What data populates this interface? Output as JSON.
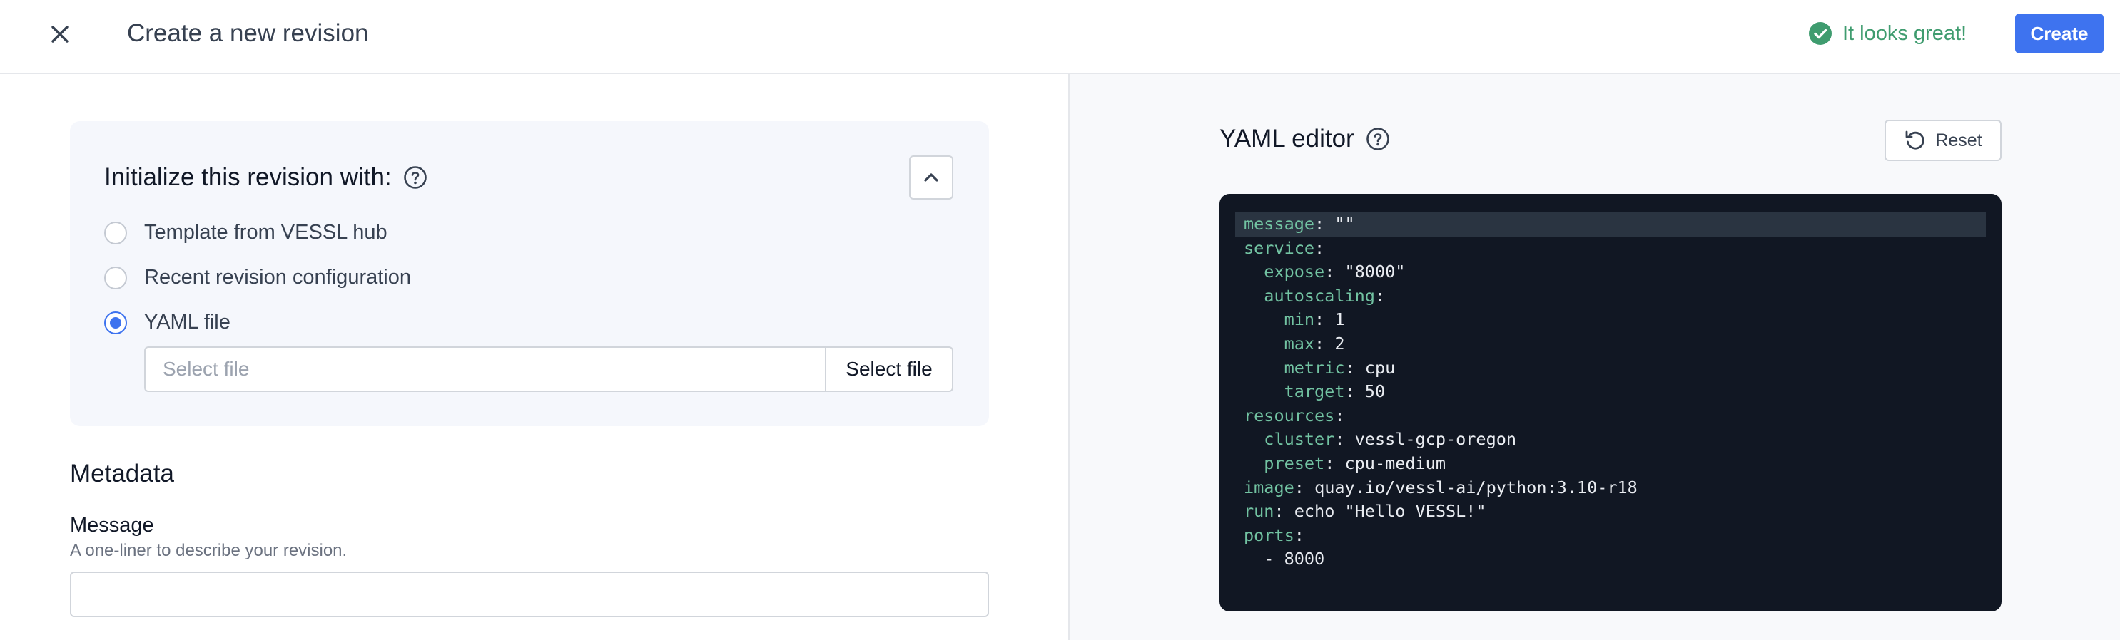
{
  "header": {
    "title": "Create a new revision",
    "status_text": "It looks great!",
    "create_label": "Create"
  },
  "init": {
    "title": "Initialize this revision with:",
    "options": [
      {
        "label": "Template from VESSL hub",
        "checked": false
      },
      {
        "label": "Recent revision configuration",
        "checked": false
      },
      {
        "label": "YAML file",
        "checked": true
      }
    ],
    "file_placeholder": "Select file",
    "file_button": "Select file"
  },
  "metadata": {
    "title": "Metadata",
    "message_label": "Message",
    "message_help": "A one-liner to describe your revision.",
    "message_value": ""
  },
  "yaml": {
    "title": "YAML editor",
    "reset_label": "Reset",
    "lines": [
      {
        "indent": "",
        "key": "message",
        "value": "\"\""
      },
      {
        "indent": "",
        "key": "service",
        "value": ""
      },
      {
        "indent": "  ",
        "key": "expose",
        "value": "\"8000\""
      },
      {
        "indent": "  ",
        "key": "autoscaling",
        "value": ""
      },
      {
        "indent": "    ",
        "key": "min",
        "value": "1"
      },
      {
        "indent": "    ",
        "key": "max",
        "value": "2"
      },
      {
        "indent": "    ",
        "key": "metric",
        "value": "cpu"
      },
      {
        "indent": "    ",
        "key": "target",
        "value": "50"
      },
      {
        "indent": "",
        "key": "resources",
        "value": ""
      },
      {
        "indent": "  ",
        "key": "cluster",
        "value": "vessl-gcp-oregon"
      },
      {
        "indent": "  ",
        "key": "preset",
        "value": "cpu-medium"
      },
      {
        "indent": "",
        "key": "image",
        "value": "quay.io/vessl-ai/python:3.10-r18"
      },
      {
        "indent": "",
        "key": "run",
        "value": "echo \"Hello VESSL!\""
      },
      {
        "indent": "",
        "key": "ports",
        "value": ""
      },
      {
        "indent": "  ",
        "key": "",
        "value": "- 8000"
      }
    ]
  },
  "colors": {
    "accent": "#3e73ef",
    "success": "#3f9c6f",
    "editor_bg": "#111723",
    "yaml_key": "#72c3a2"
  },
  "icons": {
    "close": "close-icon",
    "status": "check-circle-icon",
    "help": "help-circle-icon",
    "collapse": "chevron-up-icon",
    "reset": "reset-icon"
  }
}
